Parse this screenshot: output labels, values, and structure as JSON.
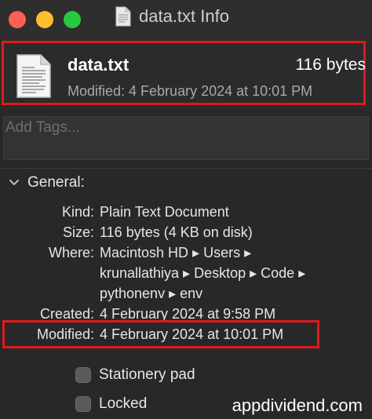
{
  "window": {
    "title": "data.txt Info",
    "traffic_lights": {
      "close": "#fe5f57",
      "minimize": "#febc2e",
      "zoom": "#28c840"
    }
  },
  "header": {
    "file_name": "data.txt",
    "file_size": "116 bytes",
    "modified": "Modified: 4 February 2024 at 10:01 PM",
    "icon": "text-document-icon"
  },
  "tags": {
    "placeholder": "Add Tags..."
  },
  "general": {
    "label": "General:",
    "rows": {
      "kind": {
        "key": "Kind:",
        "value": "Plain Text Document"
      },
      "size": {
        "key": "Size:",
        "value": "116 bytes (4 KB on disk)"
      },
      "where": {
        "key": "Where:",
        "lines": [
          "Macintosh HD ▸ Users ▸",
          "krunallathiya ▸ Desktop ▸ Code ▸",
          "pythonenv ▸ env"
        ]
      },
      "created": {
        "key": "Created:",
        "value": "4 February 2024 at 9:58 PM"
      },
      "modified": {
        "key": "Modified:",
        "value": "4 February 2024 at 10:01 PM"
      }
    },
    "checkboxes": {
      "stationery": {
        "label": "Stationery pad",
        "checked": false
      },
      "locked": {
        "label": "Locked",
        "checked": false
      }
    }
  },
  "watermark": "appdividend.com",
  "colors": {
    "highlight_border": "#e0191d"
  }
}
